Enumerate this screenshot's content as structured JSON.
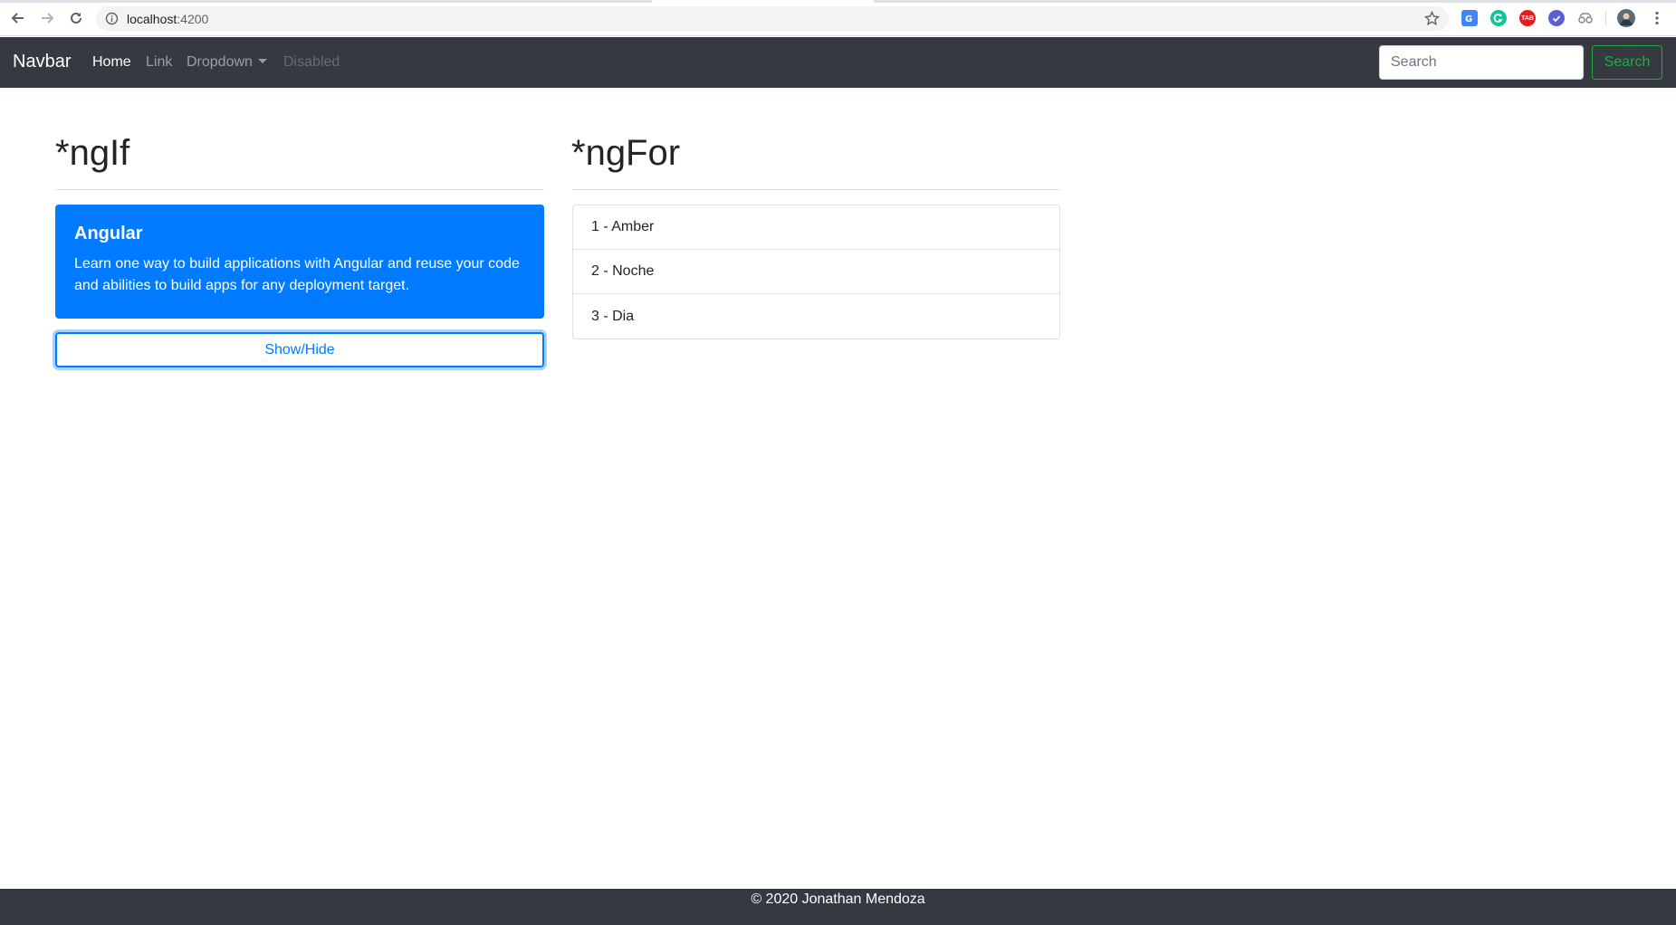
{
  "browser": {
    "url_host": "localhost",
    "url_port": ":4200",
    "icons": [
      "back-arrow-icon",
      "forward-arrow-icon",
      "reload-icon",
      "info-icon",
      "bookmark-star-icon",
      "translate-icon",
      "grammarly-icon",
      "tab-extension-icon",
      "check-extension-icon",
      "incognito-extension-icon",
      "profile-avatar-icon",
      "more-menu-icon"
    ],
    "tab_ext_label": "TAB"
  },
  "navbar": {
    "brand": "Navbar",
    "links": [
      {
        "label": "Home",
        "state": "active"
      },
      {
        "label": "Link",
        "state": "normal"
      },
      {
        "label": "Dropdown",
        "state": "dropdown"
      },
      {
        "label": "Disabled",
        "state": "disabled"
      }
    ],
    "search_placeholder": "Search",
    "search_button": "Search",
    "colors": {
      "background": "#343a40",
      "success": "#28a745"
    }
  },
  "main": {
    "ngif": {
      "heading": "*ngIf",
      "card": {
        "title": "Angular",
        "text": "Learn one way to build applications with Angular and reuse your code and abilities to build apps for any deployment target.",
        "color": "#007bff"
      },
      "toggle_button": "Show/Hide"
    },
    "ngfor": {
      "heading": "*ngFor",
      "items": [
        "1 - Amber",
        "2 - Noche",
        "3 - Dia"
      ]
    }
  },
  "footer": {
    "text": "© 2020 Jonathan Mendoza"
  }
}
